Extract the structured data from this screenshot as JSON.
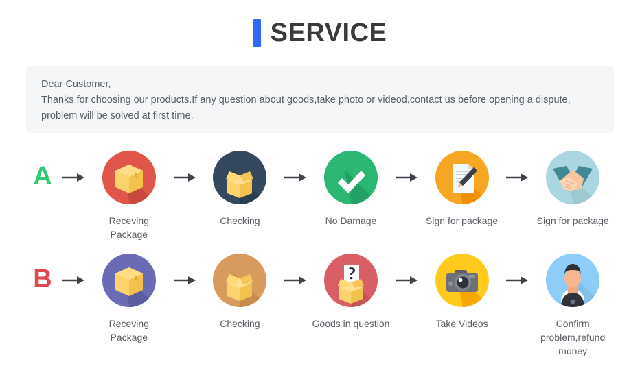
{
  "header": {
    "title": "SERVICE",
    "accent_color": "#2f6bf2",
    "title_color": "#3a3a3a"
  },
  "notice": {
    "background": "#f5f6f8",
    "lines": [
      "Dear Customer,",
      "Thanks for choosing our products.If any question about goods,take photo or videod,contact us before opening a dispute,",
      "problem will be solved at first time."
    ]
  },
  "flow": {
    "arrow_color": "#3f4349",
    "rows": [
      {
        "letter": "A",
        "letter_color": "#2ecc71",
        "steps": [
          {
            "label": "Receving Package",
            "icon": "package-box-icon",
            "circle_color": "#e0564a",
            "shadow_color": "#c9483d"
          },
          {
            "label": "Checking",
            "icon": "open-box-icon",
            "circle_color": "#34495e",
            "shadow_color": "#2b3e50"
          },
          {
            "label": "No Damage",
            "icon": "checkmark-icon",
            "circle_color": "#2bb673",
            "shadow_color": "#23a063"
          },
          {
            "label": "Sign for package",
            "icon": "document-pen-icon",
            "circle_color": "#f5a623",
            "shadow_color": "#ef9000"
          },
          {
            "label": "Sign for package",
            "icon": "handshake-icon",
            "circle_color": "#a9d6e0",
            "shadow_color": "#94c8d4"
          }
        ]
      },
      {
        "letter": "B",
        "letter_color": "#e04550",
        "steps": [
          {
            "label": "Receving Package",
            "icon": "package-box-icon",
            "circle_color": "#6a6ab5",
            "shadow_color": "#5c5ca3"
          },
          {
            "label": "Checking",
            "icon": "open-box-icon",
            "circle_color": "#d89b5e",
            "shadow_color": "#c98c4f"
          },
          {
            "label": "Goods in question",
            "icon": "question-box-icon",
            "circle_color": "#d75f65",
            "shadow_color": "#c5545a"
          },
          {
            "label": "Take Videos",
            "icon": "camera-icon",
            "circle_color": "#ffc91d",
            "shadow_color": "#f7a800"
          },
          {
            "label": "Confirm  problem,refund money",
            "icon": "customer-support-icon",
            "circle_color": "#8ecdf7",
            "shadow_color": "#6fbcf2"
          }
        ]
      }
    ]
  }
}
